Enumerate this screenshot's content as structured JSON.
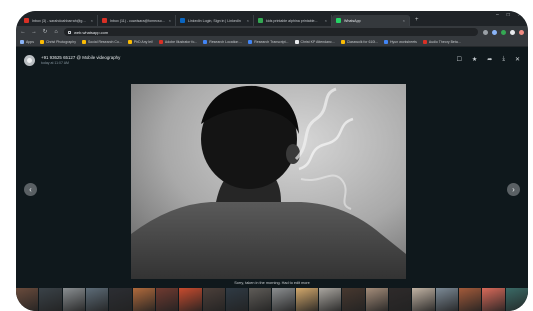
{
  "browser": {
    "tabs": [
      {
        "label": "Inbox (3) - sarahdoahbarrah@gmai...",
        "color": "#d93025",
        "active": false
      },
      {
        "label": "Inbox (11) - cuwdsara@fomecso...",
        "color": "#d93025",
        "active": false
      },
      {
        "label": "LinkedIn Login, Sign in | LinkedIn",
        "color": "#0a66c2",
        "active": false
      },
      {
        "label": "kids printable alphina printable...",
        "color": "#34a853",
        "active": false
      },
      {
        "label": "WhatsApp",
        "color": "#25d366",
        "active": true
      }
    ],
    "new_tab": "+",
    "window_controls": [
      "–",
      "□",
      "✕"
    ],
    "url": "web.whatsapp.com",
    "bookmarks": [
      {
        "label": "Apps",
        "color": "#8ab4f8"
      },
      {
        "label": "Christ Photography",
        "color": "#fbbc04"
      },
      {
        "label": "Social Research Co...",
        "color": "#fbbc04"
      },
      {
        "label": "PhD Any lei!",
        "color": "#fbbc04"
      },
      {
        "label": "Adobe Illustrator fo...",
        "color": "#d93025"
      },
      {
        "label": "Research Location ...",
        "color": "#4285f4"
      },
      {
        "label": "Research Transcript...",
        "color": "#4285f4"
      },
      {
        "label": "Christ KP Attendanc...",
        "color": "#e8eaed"
      },
      {
        "label": "Classwolk for 610l...",
        "color": "#fbbc04"
      },
      {
        "label": "Hyun worksheets",
        "color": "#4285f4"
      },
      {
        "label": "Audio Theory Beta...",
        "color": "#d93025"
      }
    ]
  },
  "viewer": {
    "sender_name": "+91 93625 65127 @ Mobile videography",
    "sender_time": "today at 11:07 AM",
    "actions": [
      "☐",
      "★",
      "➦",
      "⤓",
      "✕"
    ],
    "prev_arrow": "‹",
    "next_arrow": "›",
    "caption": "Sorry, taken in the morning. Had to edit more"
  },
  "thumbnails": [
    "#6a4b3c",
    "#3a4248",
    "#8a8f92",
    "#5d6c78",
    "#2c2e33",
    "#b06a3c",
    "#703a30",
    "#c74b2e",
    "#4b3f3a",
    "#2f3a44",
    "#5f5c58",
    "#8c8f91",
    "#d2a86c",
    "#aaa6a0",
    "#47382f",
    "#a48d7a",
    "#2e2a2a",
    "#c1b3a4",
    "#7c8a96",
    "#a35a3a",
    "#d96a5a",
    "#3a6a66"
  ]
}
